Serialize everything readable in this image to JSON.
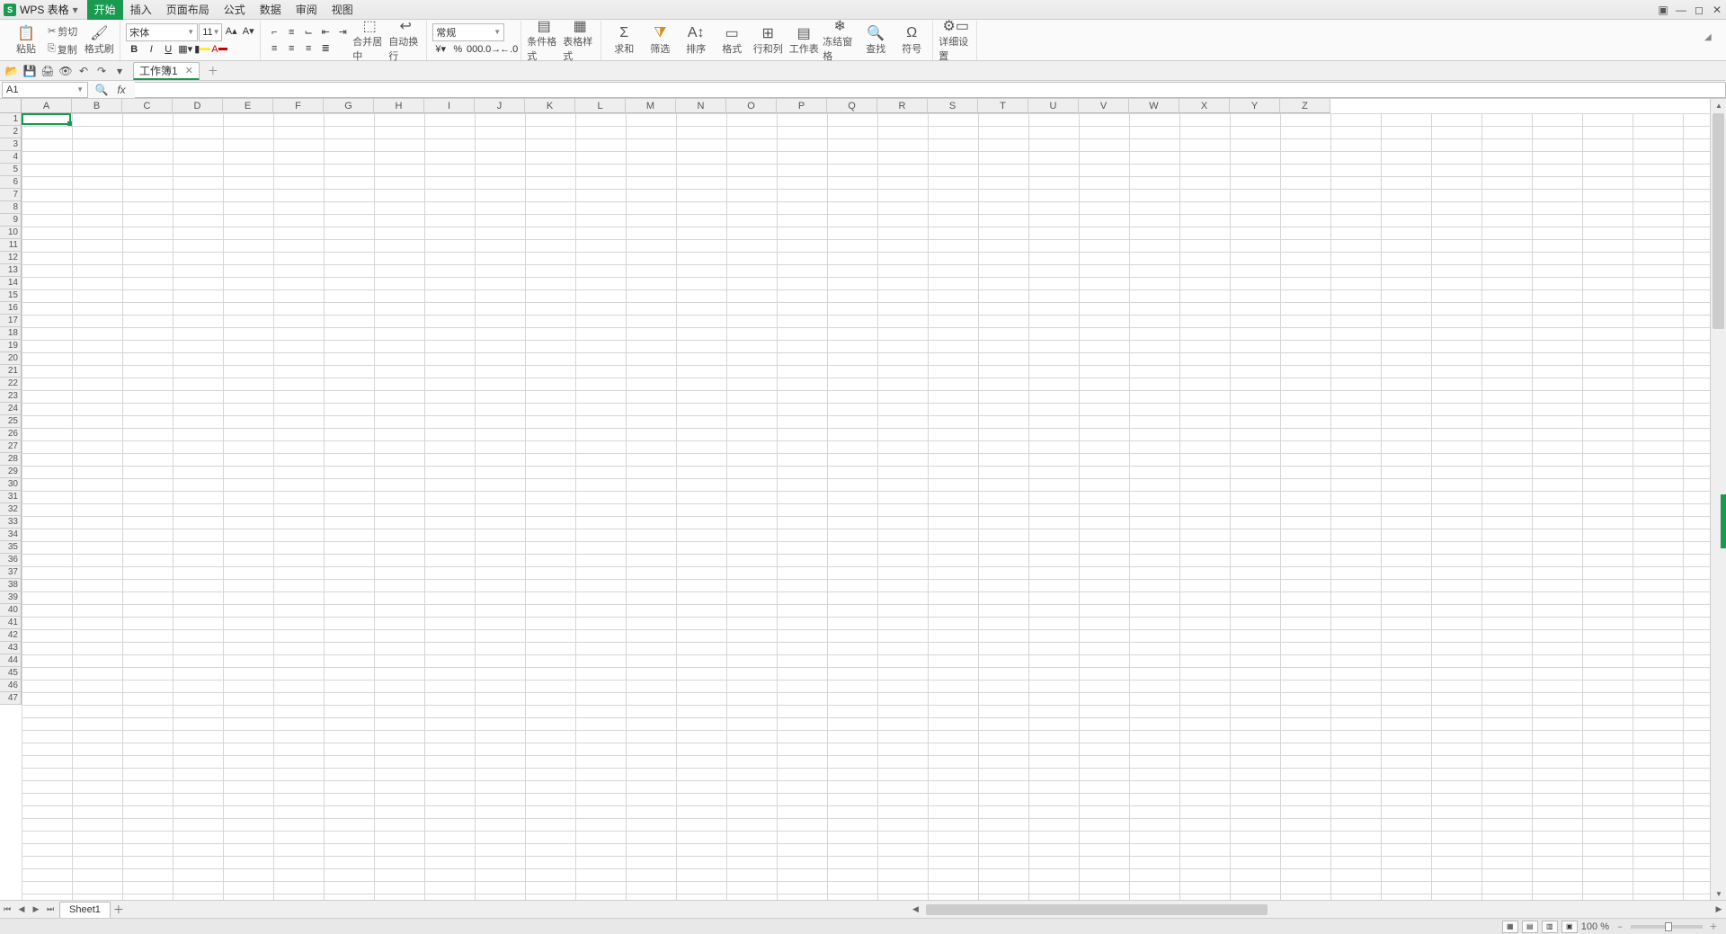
{
  "app": {
    "logo": "S",
    "name": "WPS 表格"
  },
  "menu": {
    "items": [
      "开始",
      "插入",
      "页面布局",
      "公式",
      "数据",
      "审阅",
      "视图"
    ],
    "active_index": 0
  },
  "ribbon": {
    "paste": "粘贴",
    "cut": "剪切",
    "copy": "复制",
    "format_painter": "格式刷",
    "font_name": "宋体",
    "font_size": "11",
    "number_format": "常规",
    "merge_center": "合并居中",
    "wrap_text": "自动换行",
    "cond_fmt": "条件格式",
    "table_style": "表格样式",
    "sum": "求和",
    "filter": "筛选",
    "sort": "排序",
    "format": "格式",
    "rowcol": "行和列",
    "worksheet": "工作表",
    "freeze": "冻结窗格",
    "find": "查找",
    "symbol": "符号",
    "settings": "详细设置"
  },
  "quick": {
    "doc_tab": "工作簿1"
  },
  "fx": {
    "namebox": "A1",
    "fx_label": "fx"
  },
  "grid": {
    "columns": [
      "A",
      "B",
      "C",
      "D",
      "E",
      "F",
      "G",
      "H",
      "I",
      "J",
      "K",
      "L",
      "M",
      "N",
      "O",
      "P",
      "Q",
      "R",
      "S",
      "T",
      "U",
      "V",
      "W",
      "X",
      "Y",
      "Z"
    ],
    "rows": 47
  },
  "sheets": {
    "active": "Sheet1"
  },
  "status": {
    "zoom": "100 %"
  }
}
